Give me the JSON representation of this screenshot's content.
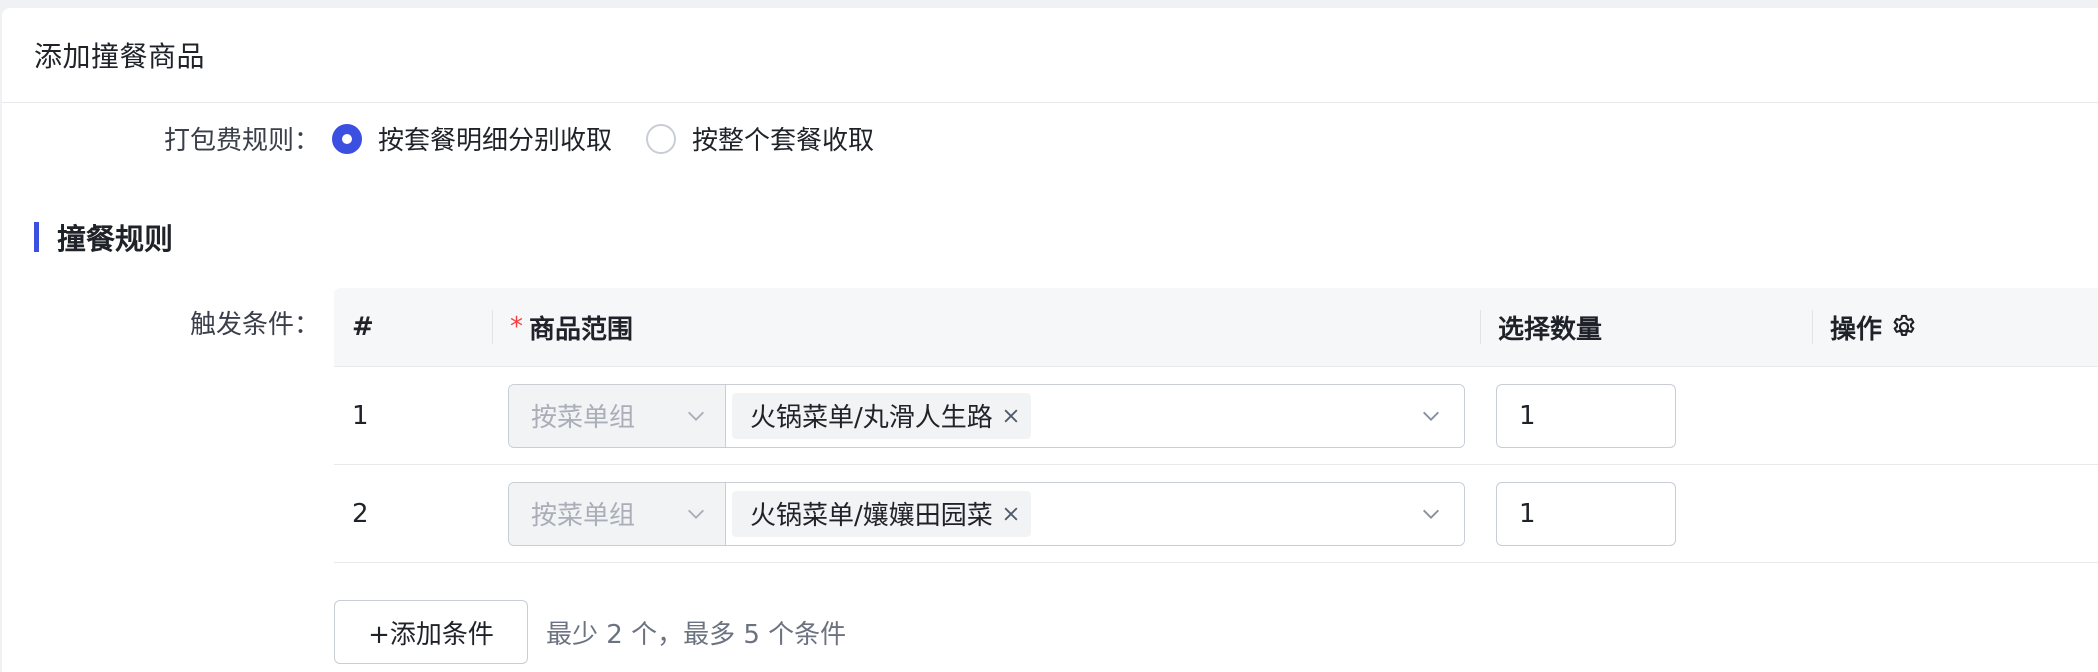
{
  "header": {
    "title": "添加撞餐商品"
  },
  "packing_fee": {
    "label": "打包费规则：",
    "options": [
      {
        "label": "按套餐明细分别收取",
        "checked": true
      },
      {
        "label": "按整个套餐收取",
        "checked": false
      }
    ]
  },
  "section": {
    "title": "撞餐规则"
  },
  "trigger": {
    "label": "触发条件：",
    "columns": {
      "index": "#",
      "required_mark": "*",
      "range": "商品范围",
      "quantity": "选择数量",
      "operation": "操作"
    },
    "rows": [
      {
        "index": "1",
        "type": "按菜单组",
        "tag": "火锅菜单/丸滑人生路",
        "quantity": "1"
      },
      {
        "index": "2",
        "type": "按菜单组",
        "tag": "火锅菜单/孃孃田园菜",
        "quantity": "1"
      }
    ],
    "add_button": "+添加条件",
    "hint": "最少 2 个，最多 5 个条件"
  },
  "icons": {
    "radio_checked": "radio-checked-icon",
    "radio_unchecked": "radio-unchecked-icon",
    "gear": "gear-icon",
    "chevron": "chevron-down-icon",
    "close": "close-icon"
  },
  "colors": {
    "accent": "#3b4fe0",
    "required": "#f53f3f",
    "border": "#c9cdd4",
    "muted": "#a9aeb8"
  }
}
